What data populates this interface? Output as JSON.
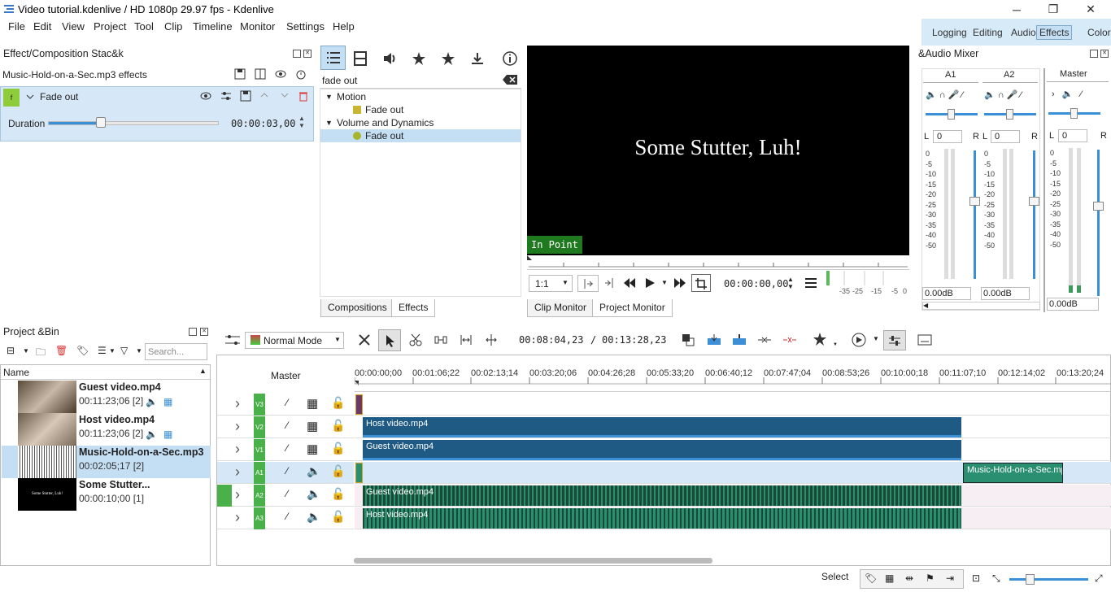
{
  "window": {
    "title": "Video tutorial.kdenlive / HD 1080p 29.97 fps - Kdenlive",
    "minimize": "─",
    "maximize": "❐",
    "close": "✕"
  },
  "menu": [
    "File",
    "Edit",
    "View",
    "Project",
    "Tool",
    "Clip",
    "Timeline",
    "Monitor",
    "Settings",
    "Help"
  ],
  "layouts": {
    "items": [
      "Logging",
      "Editing",
      "Audio",
      "Effects",
      "Color"
    ],
    "active": "Effects"
  },
  "effect_stack": {
    "title": "Effect/Composition Stac&k",
    "clip_label": "Music-Hold-on-a-Sec.mp3 effects",
    "effect_name": "Fade out",
    "duration_label": "Duration",
    "duration_value": "00:00:03,00",
    "duration_fraction": 0.31
  },
  "effects_panel": {
    "search_value": "fade out",
    "tree": [
      {
        "label": "Motion",
        "type": "group"
      },
      {
        "label": "Fade out",
        "type": "item"
      },
      {
        "label": "Volume and Dynamics",
        "type": "group"
      },
      {
        "label": "Fade out",
        "type": "item"
      }
    ],
    "tabs": [
      "Compositions",
      "Effects"
    ],
    "active_tab": "Effects"
  },
  "monitor": {
    "screen_text": "Some Stutter, Luh!",
    "in_point": "In Point",
    "zoom": "1:1",
    "timecode": "00:00:00,00",
    "meter_labels": [
      "-35",
      "-25",
      "-15",
      "-5",
      "0"
    ],
    "tabs": [
      "Clip Monitor",
      "Project Monitor"
    ],
    "active_tab": "Project Monitor"
  },
  "mixer": {
    "title": "&Audio Mixer",
    "channels": [
      {
        "name": "A1",
        "left_value": "0",
        "db": "0.00dB"
      },
      {
        "name": "A2",
        "left_value": "0",
        "db": "0.00dB"
      },
      {
        "name": "Master",
        "left_value": "0",
        "db": "0.00dB"
      }
    ],
    "scale": [
      "0",
      "-5",
      "-10",
      "-15",
      "-20",
      "-25",
      "-30",
      "-35",
      "-40",
      "-50"
    ],
    "lr": [
      "L",
      "R"
    ]
  },
  "bin": {
    "title": "Project &Bin",
    "search_placeholder": "Search...",
    "column_name": "Name",
    "items": [
      {
        "name": "Guest video.mp4",
        "meta": "00:11:23;06 [2]",
        "icons": true
      },
      {
        "name": "Host video.mp4",
        "meta": "00:11:23;06 [2]",
        "icons": true
      },
      {
        "name": "Music-Hold-on-a-Sec.mp3",
        "meta": "00:02:05;17 [2]",
        "icons": false
      },
      {
        "name": "Some Stutter...",
        "meta": "00:00:10;00 [1]",
        "icons": false
      }
    ],
    "thumb_text": "Some Stutter, Luh!"
  },
  "timeline": {
    "mode": "Normal Mode",
    "position": "00:08:04,23",
    "duration": "00:13:28,23",
    "separator": "/",
    "master_label": "Master",
    "ruler": [
      "00:00:00;00",
      "00:01:06;22",
      "00:02:13;14",
      "00:03:20;06",
      "00:04:26;28",
      "00:05:33;20",
      "00:06:40;12",
      "00:07:47;04",
      "00:08:53;26",
      "00:10:00;18",
      "00:11:07;10",
      "00:12:14;02",
      "00:13:20;24"
    ],
    "tracks": [
      {
        "name": "V3",
        "type": "video"
      },
      {
        "name": "V2",
        "type": "video",
        "clip": "Host video.mp4"
      },
      {
        "name": "V1",
        "type": "video",
        "clip": "Guest video.mp4"
      },
      {
        "name": "A1",
        "type": "audio",
        "clip": "Music-Hold-on-a-Sec.mp3"
      },
      {
        "name": "A2",
        "type": "audio",
        "clip": "Guest video.mp4"
      },
      {
        "name": "A3",
        "type": "audio",
        "clip": "Host video.mp4"
      }
    ]
  },
  "status": {
    "mode": "Select"
  },
  "colors": {
    "accent": "#c4def4",
    "video_clip": "#1f5a84",
    "audio_clip": "#2a8f70",
    "track_green": "#4ab04a",
    "in_point": "#1f7a1f"
  }
}
